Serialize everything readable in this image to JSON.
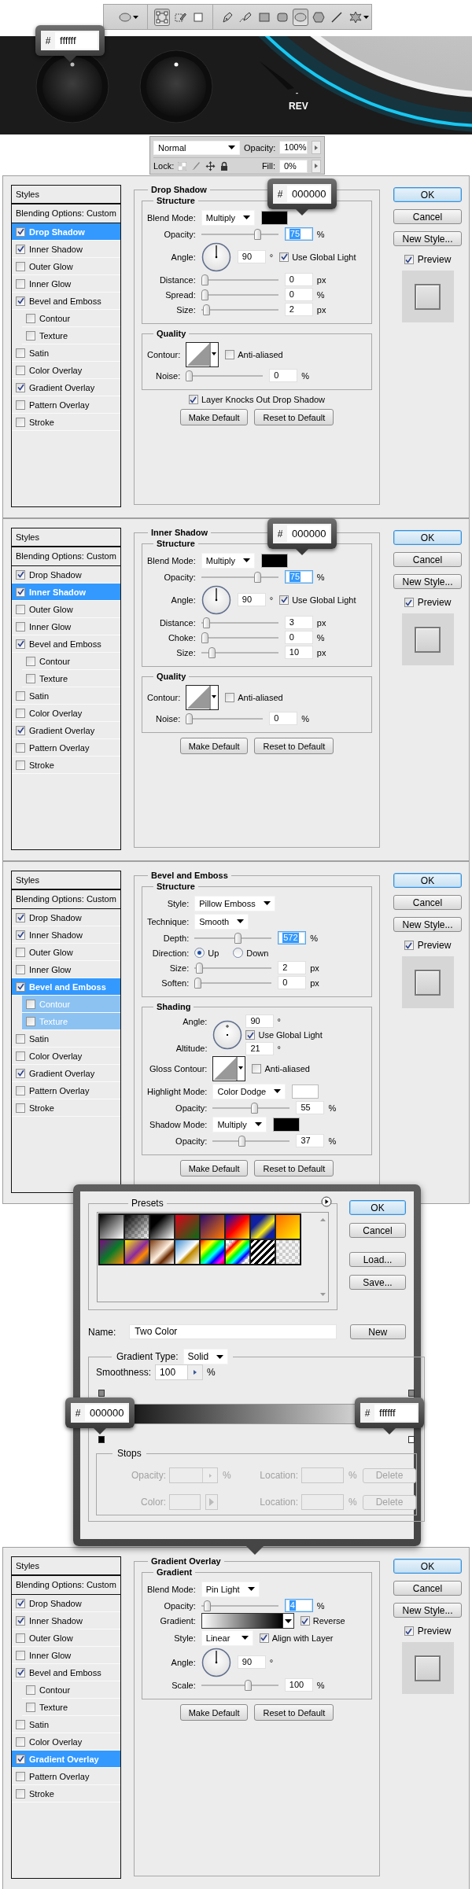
{
  "toolbar": {
    "groups": [
      {
        "tools": [
          {
            "kind": "ellipse",
            "selected": false,
            "dropdown": true
          }
        ]
      },
      {
        "tools": [
          {
            "kind": "layers",
            "selected": true,
            "dropdown": false
          },
          {
            "kind": "paths",
            "selected": false,
            "dropdown": false
          },
          {
            "kind": "pixels",
            "selected": false,
            "dropdown": false
          }
        ]
      },
      {
        "tools": [
          {
            "kind": "pen",
            "selected": false,
            "dropdown": false
          },
          {
            "kind": "freeform",
            "selected": false,
            "dropdown": false
          },
          {
            "kind": "rectangle",
            "selected": false,
            "dropdown": false
          },
          {
            "kind": "rounded",
            "selected": false,
            "dropdown": false
          },
          {
            "kind": "ellipse",
            "selected": true,
            "dropdown": false
          },
          {
            "kind": "polygon",
            "selected": false,
            "dropdown": false
          },
          {
            "kind": "line",
            "selected": false,
            "dropdown": false
          },
          {
            "kind": "custom",
            "selected": false,
            "dropdown": true
          }
        ]
      }
    ]
  },
  "canvas": {
    "tooltip": {
      "hash": "#",
      "value": "ffffff"
    },
    "mark": "-",
    "label": "REV"
  },
  "layers_panel": {
    "blend_mode": "Normal",
    "opacity_label": "Opacity:",
    "opacity": "100%",
    "lock_label": "Lock:",
    "fill_label": "Fill:",
    "fill": "0%"
  },
  "dialogs": [
    {
      "tooltip": {
        "hash": "#",
        "value": "000000"
      },
      "styles": [
        {
          "kind": "header",
          "label": "Styles"
        },
        {
          "kind": "header",
          "label": "Blending Options: Custom"
        },
        {
          "kind": "effect",
          "label": "Drop Shadow",
          "checked": true,
          "selected": true
        },
        {
          "kind": "effect",
          "label": "Inner Shadow",
          "checked": true,
          "selected": false
        },
        {
          "kind": "effect",
          "label": "Outer Glow",
          "checked": false,
          "selected": false
        },
        {
          "kind": "effect",
          "label": "Inner Glow",
          "checked": false,
          "selected": false
        },
        {
          "kind": "effect",
          "label": "Bevel and Emboss",
          "checked": true,
          "selected": false
        },
        {
          "kind": "sub",
          "label": "Contour",
          "checked": false,
          "selected": false
        },
        {
          "kind": "sub",
          "label": "Texture",
          "checked": false,
          "selected": false
        },
        {
          "kind": "effect",
          "label": "Satin",
          "checked": false,
          "selected": false
        },
        {
          "kind": "effect",
          "label": "Color Overlay",
          "checked": false,
          "selected": false
        },
        {
          "kind": "effect",
          "label": "Gradient Overlay",
          "checked": true,
          "selected": false
        },
        {
          "kind": "effect",
          "label": "Pattern Overlay",
          "checked": false,
          "selected": false
        },
        {
          "kind": "effect",
          "label": "Stroke",
          "checked": false,
          "selected": false
        }
      ],
      "panel": {
        "title": "Drop Shadow",
        "groups": [
          {
            "title": "Structure",
            "rows": [
              {
                "kind": "select",
                "label": "Blend Mode:",
                "value": "Multiply",
                "color": "#000000"
              },
              {
                "kind": "slider",
                "label": "Opacity:",
                "level": 0.75,
                "value": "75",
                "unit": "%",
                "value_selected": true
              },
              {
                "kind": "angle",
                "label": "Angle:",
                "value": "90",
                "unit": "°",
                "check": {
                  "label": "Use Global Light",
                  "checked": true
                }
              },
              {
                "kind": "slider",
                "label": "Distance:",
                "level": 0,
                "value": "0",
                "unit": "px",
                "value_selected": false
              },
              {
                "kind": "slider",
                "label": "Spread:",
                "level": 0,
                "value": "0",
                "unit": "%",
                "value_selected": false
              },
              {
                "kind": "slider",
                "label": "Size:",
                "level": 0.02,
                "value": "2",
                "unit": "px",
                "value_selected": false
              }
            ]
          },
          {
            "title": "Quality",
            "rows": [
              {
                "kind": "contour",
                "label": "Contour:",
                "check": {
                  "label": "Anti-aliased",
                  "checked": false
                }
              },
              {
                "kind": "slider",
                "label": "Noise:",
                "level": 0,
                "value": "0",
                "unit": "%",
                "value_selected": false
              }
            ]
          }
        ],
        "check": {
          "label": "Layer Knocks Out Drop Shadow",
          "checked": true
        },
        "buttons": [
          "Make Default",
          "Reset to Default"
        ]
      },
      "buttons": [
        "OK",
        "Cancel",
        "New Style..."
      ],
      "preview": {
        "label": "Preview",
        "checked": true
      }
    },
    {
      "tooltip": {
        "hash": "#",
        "value": "000000"
      },
      "styles": [
        {
          "kind": "header",
          "label": "Styles"
        },
        {
          "kind": "header",
          "label": "Blending Options: Custom"
        },
        {
          "kind": "effect",
          "label": "Drop Shadow",
          "checked": true,
          "selected": false
        },
        {
          "kind": "effect",
          "label": "Inner Shadow",
          "checked": true,
          "selected": true
        },
        {
          "kind": "effect",
          "label": "Outer Glow",
          "checked": false,
          "selected": false
        },
        {
          "kind": "effect",
          "label": "Inner Glow",
          "checked": false,
          "selected": false
        },
        {
          "kind": "effect",
          "label": "Bevel and Emboss",
          "checked": true,
          "selected": false
        },
        {
          "kind": "sub",
          "label": "Contour",
          "checked": false,
          "selected": false
        },
        {
          "kind": "sub",
          "label": "Texture",
          "checked": false,
          "selected": false
        },
        {
          "kind": "effect",
          "label": "Satin",
          "checked": false,
          "selected": false
        },
        {
          "kind": "effect",
          "label": "Color Overlay",
          "checked": false,
          "selected": false
        },
        {
          "kind": "effect",
          "label": "Gradient Overlay",
          "checked": true,
          "selected": false
        },
        {
          "kind": "effect",
          "label": "Pattern Overlay",
          "checked": false,
          "selected": false
        },
        {
          "kind": "effect",
          "label": "Stroke",
          "checked": false,
          "selected": false
        }
      ],
      "panel": {
        "title": "Inner Shadow",
        "groups": [
          {
            "title": "Structure",
            "rows": [
              {
                "kind": "select",
                "label": "Blend Mode:",
                "value": "Multiply",
                "color": "#000000"
              },
              {
                "kind": "slider",
                "label": "Opacity:",
                "level": 0.75,
                "value": "75",
                "unit": "%",
                "value_selected": true
              },
              {
                "kind": "angle",
                "label": "Angle:",
                "value": "90",
                "unit": "°",
                "check": {
                  "label": "Use Global Light",
                  "checked": true
                }
              },
              {
                "kind": "slider",
                "label": "Distance:",
                "level": 0.03,
                "value": "3",
                "unit": "px",
                "value_selected": false
              },
              {
                "kind": "slider",
                "label": "Choke:",
                "level": 0,
                "value": "0",
                "unit": "%",
                "value_selected": false
              },
              {
                "kind": "slider",
                "label": "Size:",
                "level": 0.1,
                "value": "10",
                "unit": "px",
                "value_selected": false
              }
            ]
          },
          {
            "title": "Quality",
            "rows": [
              {
                "kind": "contour",
                "label": "Contour:",
                "check": {
                  "label": "Anti-aliased",
                  "checked": false
                }
              },
              {
                "kind": "slider",
                "label": "Noise:",
                "level": 0,
                "value": "0",
                "unit": "%",
                "value_selected": false
              }
            ]
          }
        ],
        "buttons": [
          "Make Default",
          "Reset to Default"
        ]
      },
      "buttons": [
        "OK",
        "Cancel",
        "New Style..."
      ],
      "preview": {
        "label": "Preview",
        "checked": true
      }
    },
    {
      "styles": [
        {
          "kind": "header",
          "label": "Styles"
        },
        {
          "kind": "header",
          "label": "Blending Options: Custom"
        },
        {
          "kind": "effect",
          "label": "Drop Shadow",
          "checked": true,
          "selected": false
        },
        {
          "kind": "effect",
          "label": "Inner Shadow",
          "checked": true,
          "selected": false
        },
        {
          "kind": "effect",
          "label": "Outer Glow",
          "checked": false,
          "selected": false
        },
        {
          "kind": "effect",
          "label": "Inner Glow",
          "checked": false,
          "selected": false
        },
        {
          "kind": "effect",
          "label": "Bevel and Emboss",
          "checked": true,
          "selected": true
        },
        {
          "kind": "sub",
          "label": "Contour",
          "checked": false,
          "selected": true
        },
        {
          "kind": "sub",
          "label": "Texture",
          "checked": false,
          "selected": true
        },
        {
          "kind": "effect",
          "label": "Satin",
          "checked": false,
          "selected": false
        },
        {
          "kind": "effect",
          "label": "Color Overlay",
          "checked": false,
          "selected": false
        },
        {
          "kind": "effect",
          "label": "Gradient Overlay",
          "checked": true,
          "selected": false
        },
        {
          "kind": "effect",
          "label": "Pattern Overlay",
          "checked": false,
          "selected": false
        },
        {
          "kind": "effect",
          "label": "Stroke",
          "checked": false,
          "selected": false
        }
      ],
      "panel": {
        "title": "Bevel and Emboss",
        "groups": [
          {
            "title": "Structure",
            "rows": [
              {
                "kind": "select",
                "label": "Style:",
                "value": "Pillow Emboss"
              },
              {
                "kind": "select",
                "label": "Technique:",
                "value": "Smooth"
              },
              {
                "kind": "slider",
                "label": "Depth:",
                "level": 0.57,
                "value": "572",
                "unit": "%",
                "value_selected": true
              },
              {
                "kind": "radio",
                "label": "Direction:",
                "options": [
                  {
                    "label": "Up",
                    "selected": true
                  },
                  {
                    "label": "Down",
                    "selected": false
                  }
                ]
              },
              {
                "kind": "slider",
                "label": "Size:",
                "level": 0.02,
                "value": "2",
                "unit": "px",
                "value_selected": false
              },
              {
                "kind": "slider",
                "label": "Soften:",
                "level": 0,
                "value": "0",
                "unit": "px",
                "value_selected": false
              }
            ]
          },
          {
            "title": "Shading",
            "rows": [
              {
                "kind": "shading",
                "label": "Angle:",
                "value": "90",
                "unit": "°",
                "check": {
                  "label": "Use Global Light",
                  "checked": true
                },
                "altitude_label": "Altitude:",
                "altitude": "21",
                "altitude_unit": "°"
              },
              {
                "kind": "contour",
                "label": "Gloss Contour:",
                "check": {
                  "label": "Anti-aliased",
                  "checked": false
                }
              },
              {
                "kind": "select",
                "label": "Highlight Mode:",
                "value": "Color Dodge",
                "color": "#ffffff"
              },
              {
                "kind": "slider",
                "label": "Opacity:",
                "level": 0.55,
                "value": "55",
                "unit": "%",
                "value_selected": false
              },
              {
                "kind": "select",
                "label": "Shadow Mode:",
                "value": "Multiply",
                "color": "#000000"
              },
              {
                "kind": "slider",
                "label": "Opacity:",
                "level": 0.37,
                "value": "37",
                "unit": "%",
                "value_selected": false
              }
            ]
          }
        ],
        "buttons": [
          "Make Default",
          "Reset to Default"
        ]
      },
      "buttons": [
        "OK",
        "Cancel",
        "New Style..."
      ],
      "preview": {
        "label": "Preview",
        "checked": true
      }
    },
    {
      "styles": [
        {
          "kind": "header",
          "label": "Styles"
        },
        {
          "kind": "header",
          "label": "Blending Options: Custom"
        },
        {
          "kind": "effect",
          "label": "Drop Shadow",
          "checked": true,
          "selected": false
        },
        {
          "kind": "effect",
          "label": "Inner Shadow",
          "checked": true,
          "selected": false
        },
        {
          "kind": "effect",
          "label": "Outer Glow",
          "checked": false,
          "selected": false
        },
        {
          "kind": "effect",
          "label": "Inner Glow",
          "checked": false,
          "selected": false
        },
        {
          "kind": "effect",
          "label": "Bevel and Emboss",
          "checked": true,
          "selected": false
        },
        {
          "kind": "sub",
          "label": "Contour",
          "checked": false,
          "selected": false
        },
        {
          "kind": "sub",
          "label": "Texture",
          "checked": false,
          "selected": false
        },
        {
          "kind": "effect",
          "label": "Satin",
          "checked": false,
          "selected": false
        },
        {
          "kind": "effect",
          "label": "Color Overlay",
          "checked": false,
          "selected": false
        },
        {
          "kind": "effect",
          "label": "Gradient Overlay",
          "checked": true,
          "selected": true
        },
        {
          "kind": "effect",
          "label": "Pattern Overlay",
          "checked": false,
          "selected": false
        },
        {
          "kind": "effect",
          "label": "Stroke",
          "checked": false,
          "selected": false
        }
      ],
      "panel": {
        "title": "Gradient Overlay",
        "groups": [
          {
            "title": "Gradient",
            "rows": [
              {
                "kind": "select",
                "label": "Blend Mode:",
                "value": "Pin Light"
              },
              {
                "kind": "slider",
                "label": "Opacity:",
                "level": 0.04,
                "value": "4",
                "unit": "%",
                "value_selected": true
              },
              {
                "kind": "gradient",
                "label": "Gradient:",
                "check": {
                  "label": "Reverse",
                  "checked": true
                }
              },
              {
                "kind": "select",
                "label": "Style:",
                "value": "Linear",
                "check": {
                  "label": "Align with Layer",
                  "checked": true
                }
              },
              {
                "kind": "angle",
                "label": "Angle:",
                "value": "90",
                "unit": "°"
              },
              {
                "kind": "slider",
                "label": "Scale:",
                "level": 0.62,
                "value": "100",
                "unit": "%",
                "value_selected": false
              }
            ]
          }
        ],
        "buttons": [
          "Make Default",
          "Reset to Default"
        ]
      },
      "buttons": [
        "OK",
        "Cancel",
        "New Style..."
      ],
      "preview": {
        "label": "Preview",
        "checked": true
      }
    }
  ],
  "gradient_editor": {
    "presets_title": "Presets",
    "buttons": [
      "OK",
      "Cancel",
      "Load...",
      "Save..."
    ],
    "name_label": "Name:",
    "name": "Two Color",
    "new_button": "New",
    "type_label": "Gradient Type:",
    "type": "Solid",
    "smoothness_label": "Smoothness:",
    "smoothness": "100",
    "smoothness_unit": "%",
    "stop_tooltips": [
      {
        "hash": "#",
        "value": "000000"
      },
      {
        "hash": "#",
        "value": "ffffff"
      }
    ],
    "stops_title": "Stops",
    "stop_rows": [
      {
        "kind": "opacity",
        "label": "Opacity:",
        "unit": "%",
        "location_label": "Location:",
        "location_unit": "%",
        "button": "Delete",
        "disabled": true
      },
      {
        "kind": "color",
        "label": "Color:",
        "location_label": "Location:",
        "location_unit": "%",
        "button": "Delete",
        "disabled": true
      }
    ]
  }
}
